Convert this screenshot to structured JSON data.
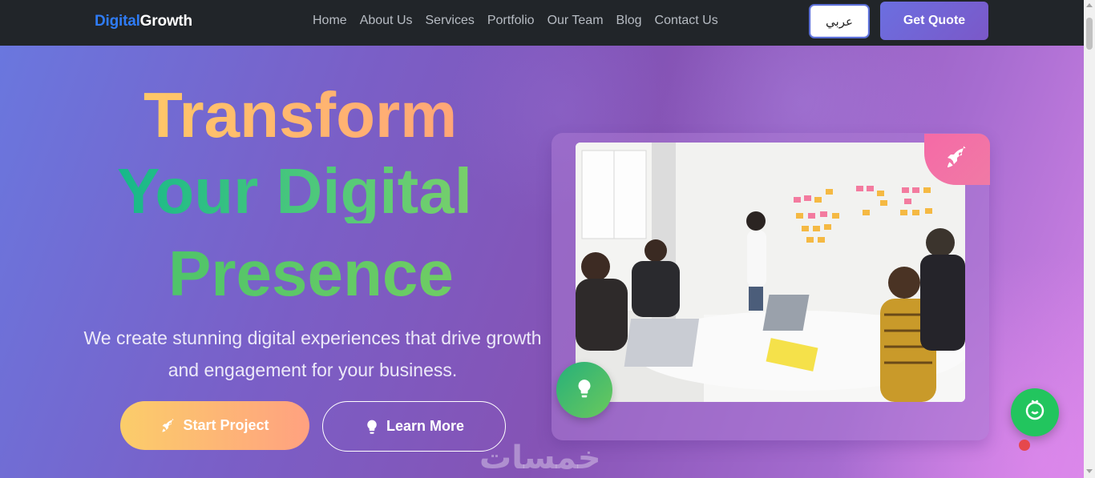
{
  "navbar": {
    "brand_part1": "Digital",
    "brand_part2": "Growth",
    "links": [
      "Home",
      "About Us",
      "Services",
      "Portfolio",
      "Our Team",
      "Blog",
      "Contact Us"
    ],
    "language_button": "عربي",
    "quote_button": "Get Quote"
  },
  "hero": {
    "title_line1": "Transform",
    "title_line2": "Your Digital",
    "title_line3": "Presence",
    "subtitle": "We create stunning digital experiences that drive growth and engagement for your business.",
    "start_button": "Start Project",
    "learn_button": "Learn More",
    "watermark": "خمسات"
  },
  "icons": {
    "start": "rocket-icon",
    "learn": "lightbulb-icon",
    "badge_top": "rocket-icon",
    "badge_bottom": "lightbulb-icon",
    "floating": "chat-icon"
  },
  "colors": {
    "brand_blue": "#2f7cf6",
    "accent_purple": "#6b6fe0",
    "title_orange": "#ffb570",
    "title_green": "#3cc47a",
    "rocket_badge": "#f56aa6",
    "bulb_badge": "#26b07a",
    "floating_button": "#22c55e"
  }
}
